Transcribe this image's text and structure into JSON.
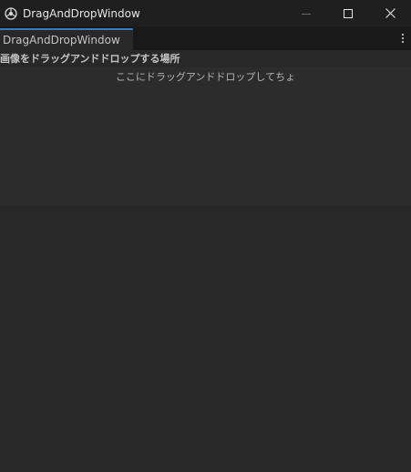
{
  "window": {
    "title": "DragAndDropWindow",
    "app_icon": "unity-icon",
    "controls": {
      "minimize": "minimize-icon",
      "maximize": "maximize-icon",
      "close": "close-icon"
    }
  },
  "tabs": [
    {
      "label": "DragAndDropWindow",
      "active": true
    }
  ],
  "tab_menu_icon": "vertical-ellipsis-icon",
  "section": {
    "header": "画像をドラッグアンドドロップする場所"
  },
  "drop_area": {
    "hint": "ここにドラッグアンドドロップしてちょ"
  },
  "colors": {
    "titlebar": "#1f1f1f",
    "background": "#282828",
    "tab_accent": "#3a79bb",
    "drop_area": "#2c2c2c"
  }
}
